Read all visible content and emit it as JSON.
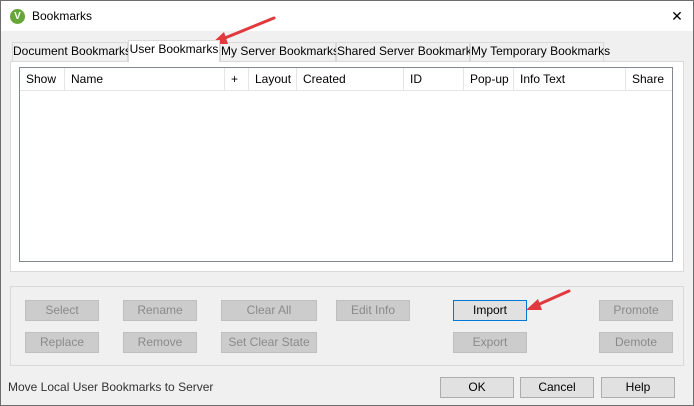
{
  "window": {
    "title": "Bookmarks",
    "icon_letter": "V",
    "close_glyph": "✕"
  },
  "tabs": [
    {
      "label": "Document Bookmarks",
      "active": false
    },
    {
      "label": "User Bookmarks",
      "active": true
    },
    {
      "label": "My Server Bookmarks",
      "active": false
    },
    {
      "label": "Shared Server Bookmarks",
      "active": false
    },
    {
      "label": "My Temporary Bookmarks",
      "active": false
    }
  ],
  "list": {
    "columns": [
      "Show",
      "Name",
      "+",
      "Layout",
      "Created",
      "ID",
      "Pop-up",
      "Info Text",
      "Share"
    ],
    "rows": []
  },
  "actions": {
    "select": "Select",
    "rename": "Rename",
    "clear_all": "Clear All",
    "edit_info": "Edit Info",
    "import": "Import",
    "promote": "Promote",
    "replace": "Replace",
    "remove": "Remove",
    "set_clear_state": "Set Clear State",
    "export": "Export",
    "demote": "Demote"
  },
  "footer": {
    "status_text": "Move Local User Bookmarks to Server",
    "ok": "OK",
    "cancel": "Cancel",
    "help": "Help"
  },
  "colors": {
    "annotation_arrow": "#e0393e",
    "focus_border": "#0078d7",
    "app_icon": "#65a637"
  }
}
